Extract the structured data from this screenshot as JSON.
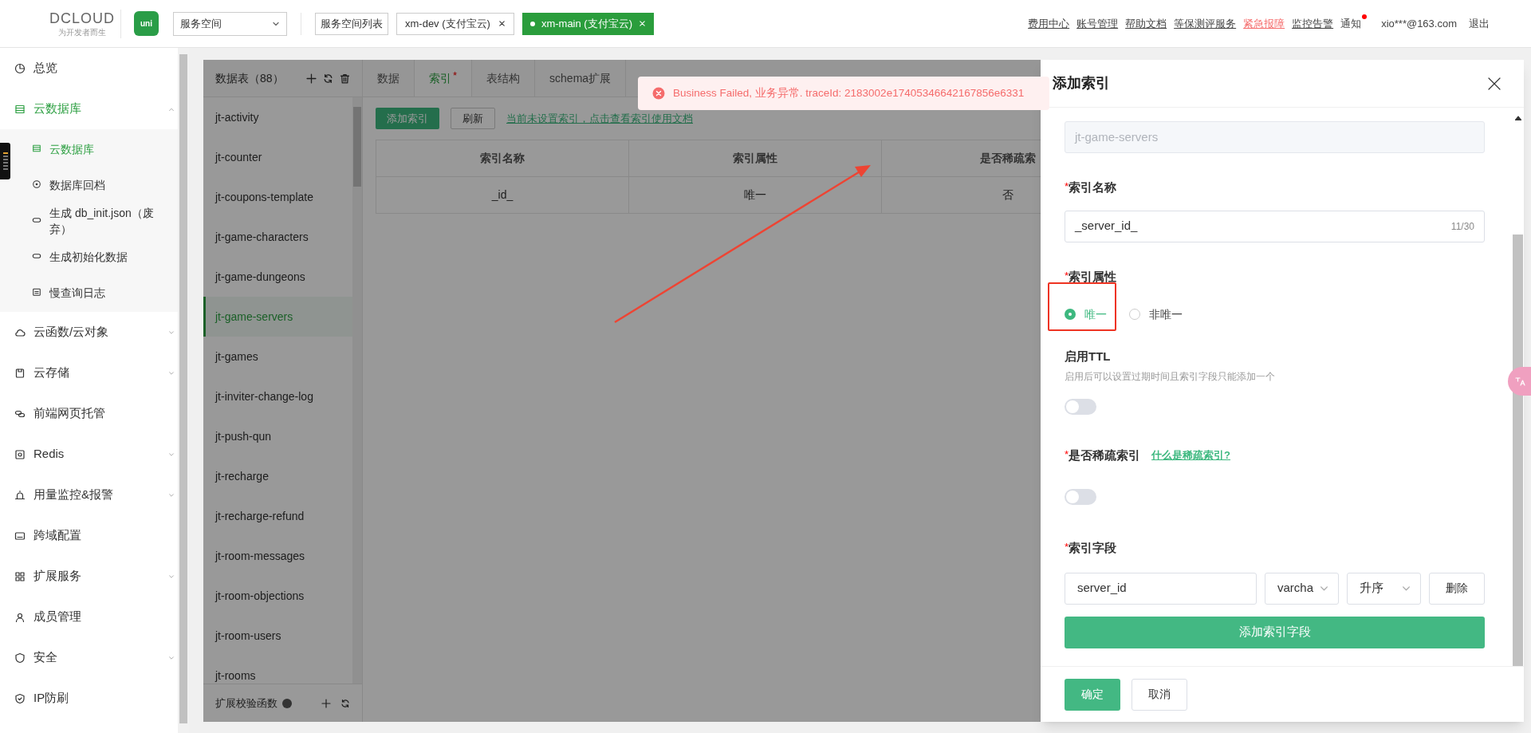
{
  "header": {
    "logo_text": "DCLOUD",
    "logo_slogan": "为开发者而生",
    "app_badge": "uni",
    "space_select": {
      "value": "服务空间"
    },
    "space_list_button": "服务空间列表",
    "space_tabs": [
      {
        "label": "xm-dev (支付宝云)",
        "selected": false
      },
      {
        "label": "xm-main (支付宝云)",
        "selected": true
      }
    ],
    "links": [
      {
        "label": "费用中心",
        "kind": "link"
      },
      {
        "label": "账号管理",
        "kind": "link"
      },
      {
        "label": "帮助文档",
        "kind": "link"
      },
      {
        "label": "等保测评服务",
        "kind": "link"
      },
      {
        "label": "紧急报障",
        "kind": "alert"
      },
      {
        "label": "监控告警",
        "kind": "link"
      },
      {
        "label": "通知",
        "kind": "notice"
      },
      {
        "label": "xio***@163.com",
        "kind": "user"
      },
      {
        "label": "退出",
        "kind": "plain"
      }
    ]
  },
  "sidebar": {
    "items": [
      {
        "label": "总览",
        "kind": "link",
        "selected": false,
        "expanded": false
      },
      {
        "label": "云数据库",
        "kind": "group",
        "selected": true,
        "expanded": true,
        "children": [
          {
            "label": "云数据库",
            "selected": true
          },
          {
            "label": "数据库回档",
            "selected": false
          },
          {
            "label": "生成 db_init.json（废弃）",
            "selected": false
          },
          {
            "label": "生成初始化数据",
            "selected": false
          },
          {
            "label": "慢查询日志",
            "selected": false
          }
        ]
      },
      {
        "label": "云函数/云对象",
        "kind": "group",
        "selected": false,
        "expanded": false
      },
      {
        "label": "云存储",
        "kind": "group",
        "selected": false,
        "expanded": false
      },
      {
        "label": "前端网页托管",
        "kind": "link",
        "selected": false,
        "expanded": false
      },
      {
        "label": "Redis",
        "kind": "group",
        "selected": false,
        "expanded": false
      },
      {
        "label": "用量监控&报警",
        "kind": "group",
        "selected": false,
        "expanded": false
      },
      {
        "label": "跨域配置",
        "kind": "link",
        "selected": false,
        "expanded": false
      },
      {
        "label": "扩展服务",
        "kind": "group",
        "selected": false,
        "expanded": false
      },
      {
        "label": "成员管理",
        "kind": "link",
        "selected": false,
        "expanded": false
      },
      {
        "label": "安全",
        "kind": "group",
        "selected": false,
        "expanded": false
      },
      {
        "label": "IP防刷",
        "kind": "link",
        "selected": false,
        "expanded": false
      }
    ]
  },
  "tables": {
    "title": "数据表（88）",
    "items": [
      {
        "label": "jt-activity",
        "selected": false
      },
      {
        "label": "jt-counter",
        "selected": false
      },
      {
        "label": "jt-coupons-template",
        "selected": false
      },
      {
        "label": "jt-game-characters",
        "selected": false
      },
      {
        "label": "jt-game-dungeons",
        "selected": false
      },
      {
        "label": "jt-game-servers",
        "selected": true
      },
      {
        "label": "jt-games",
        "selected": false
      },
      {
        "label": "jt-inviter-change-log",
        "selected": false
      },
      {
        "label": "jt-push-qun",
        "selected": false
      },
      {
        "label": "jt-recharge",
        "selected": false
      },
      {
        "label": "jt-recharge-refund",
        "selected": false
      },
      {
        "label": "jt-room-messages",
        "selected": false
      },
      {
        "label": "jt-room-objections",
        "selected": false
      },
      {
        "label": "jt-room-users",
        "selected": false
      },
      {
        "label": "jt-rooms",
        "selected": false
      }
    ],
    "footer": "扩展校验函数"
  },
  "tabs": [
    {
      "label": "数据",
      "selected": false
    },
    {
      "label": "索引",
      "selected": true,
      "badge": "*"
    },
    {
      "label": "表结构",
      "selected": false
    },
    {
      "label": "schema扩展",
      "selected": false
    }
  ],
  "toolbar": {
    "add_button": "添加索引",
    "refresh_button": "刷新",
    "doc_link": "当前未设置索引，点击查看索引使用文档"
  },
  "index_table": {
    "columns": [
      "索引名称",
      "索引属性",
      "是否稀疏索"
    ],
    "rows": [
      [
        "_id_",
        "唯一",
        "否"
      ]
    ]
  },
  "toast": {
    "kind": "error",
    "message": "Business Failed, 业务异常. traceId: 2183002e17405346642167856e6331"
  },
  "drawer": {
    "title": "添加索引",
    "table_field": {
      "value": "jt-game-servers",
      "disabled": true
    },
    "index_name": {
      "mark": "*",
      "label": "索引名称",
      "value": "_server_id_",
      "counter": "11/30"
    },
    "attribute": {
      "mark": "*",
      "label": "索引属性",
      "options": [
        {
          "label": "唯一",
          "selected": true
        },
        {
          "label": "非唯一",
          "selected": false
        }
      ]
    },
    "ttl": {
      "label": "启用TTL",
      "hint": "启用后可以设置过期时间且索引字段只能添加一个",
      "on": false
    },
    "sparse": {
      "mark": "*",
      "label": "是否稀疏索引",
      "help_link": "什么是稀疏索引?",
      "on": false
    },
    "fields": {
      "mark": "*",
      "label": "索引字段",
      "rows": [
        {
          "name": "server_id",
          "type": "varcha",
          "order": "升序",
          "delete": "删除"
        }
      ],
      "add_button": "添加索引字段"
    },
    "buttons": [
      {
        "label": "确定",
        "kind": "primary"
      },
      {
        "label": "取消",
        "kind": "default"
      }
    ]
  },
  "annotations": {
    "arrow": true,
    "highlight_box": true
  },
  "overlays": {
    "side_widget": true,
    "translate_button": true
  }
}
